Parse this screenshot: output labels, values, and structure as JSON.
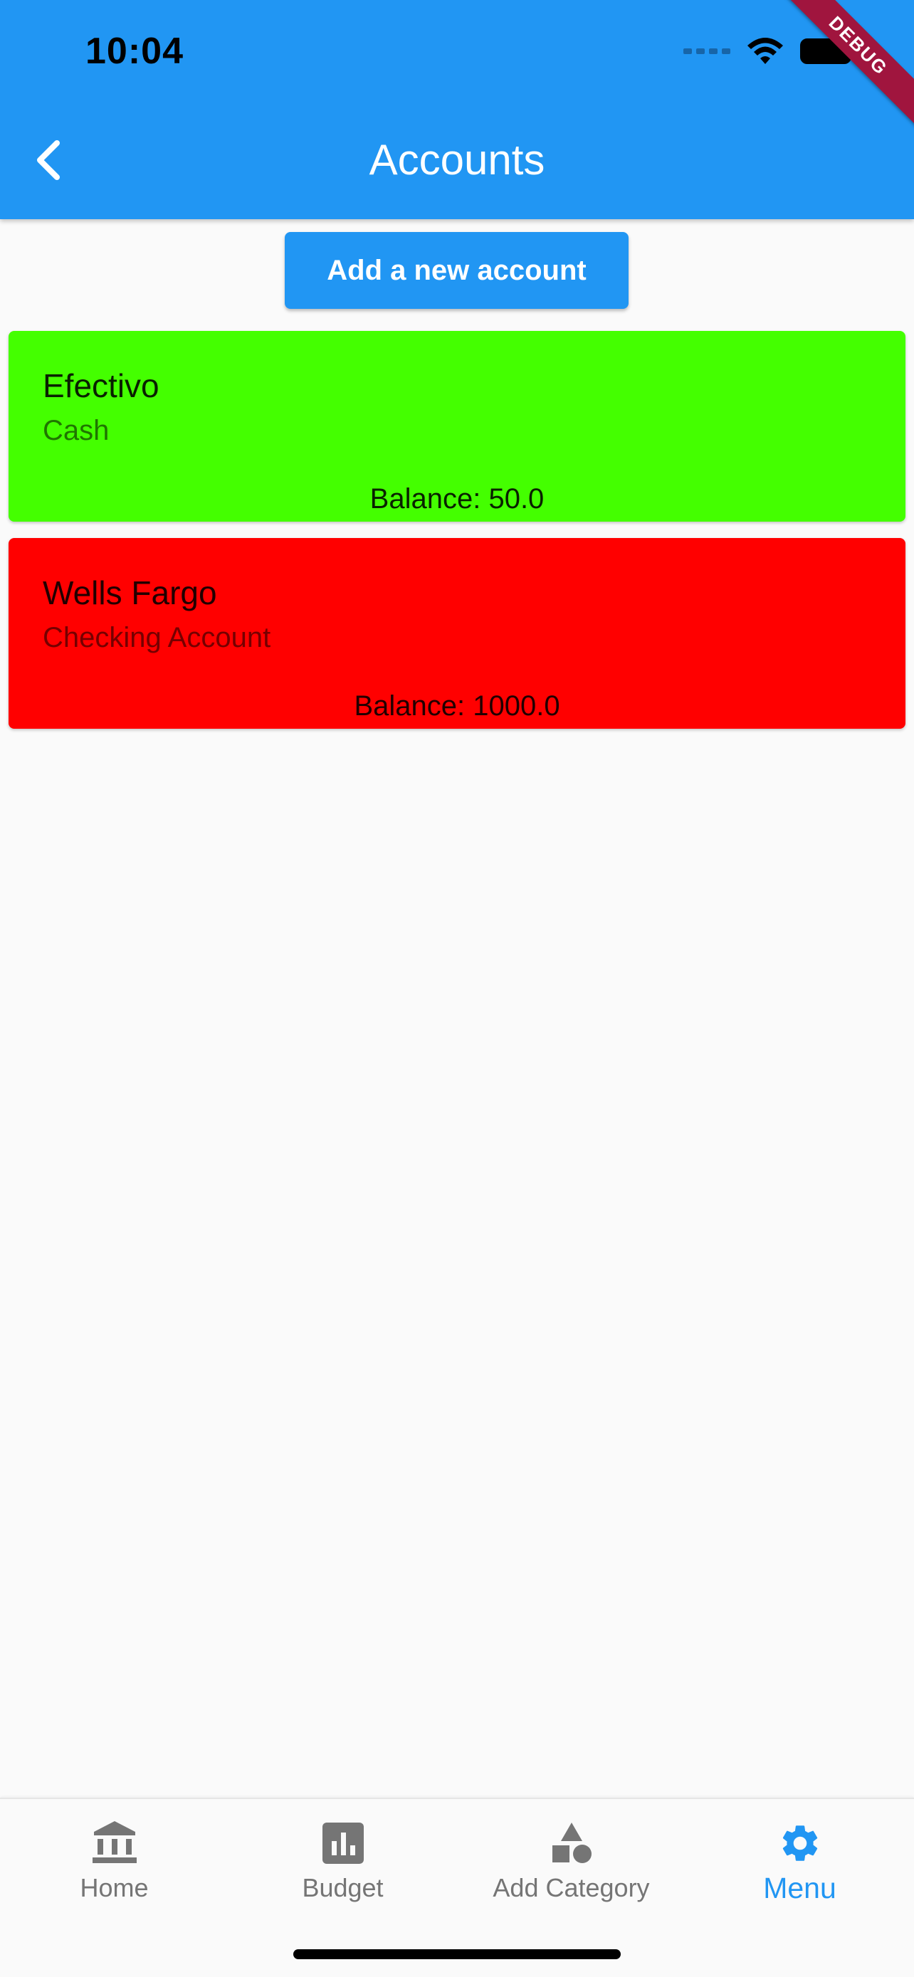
{
  "status_bar": {
    "time": "10:04",
    "icons": [
      "cellular-dots-icon",
      "wifi-icon",
      "battery-icon"
    ],
    "debug_banner": "DEBUG"
  },
  "app_bar": {
    "title": "Accounts",
    "back_icon": "chevron-left-icon",
    "color": "#2196f3"
  },
  "add_account": {
    "label": "Add a new account",
    "color": "#2196f3"
  },
  "accounts": [
    {
      "name": "Efectivo",
      "type": "Cash",
      "balance": "Balance: 50.0",
      "color": "#44ff00"
    },
    {
      "name": "Wells Fargo",
      "type": "Checking Account",
      "balance": "Balance: 1000.0",
      "color": "#ff0000"
    }
  ],
  "bottom_nav": {
    "active_color": "#2196f3",
    "inactive_color": "#757575",
    "items": [
      {
        "label": "Home",
        "icon": "bank-icon",
        "active": false
      },
      {
        "label": "Budget",
        "icon": "bar-chart-icon",
        "active": false
      },
      {
        "label": "Add Category",
        "icon": "category-shapes-icon",
        "active": false
      },
      {
        "label": "Menu",
        "icon": "gear-icon",
        "active": true
      }
    ]
  }
}
